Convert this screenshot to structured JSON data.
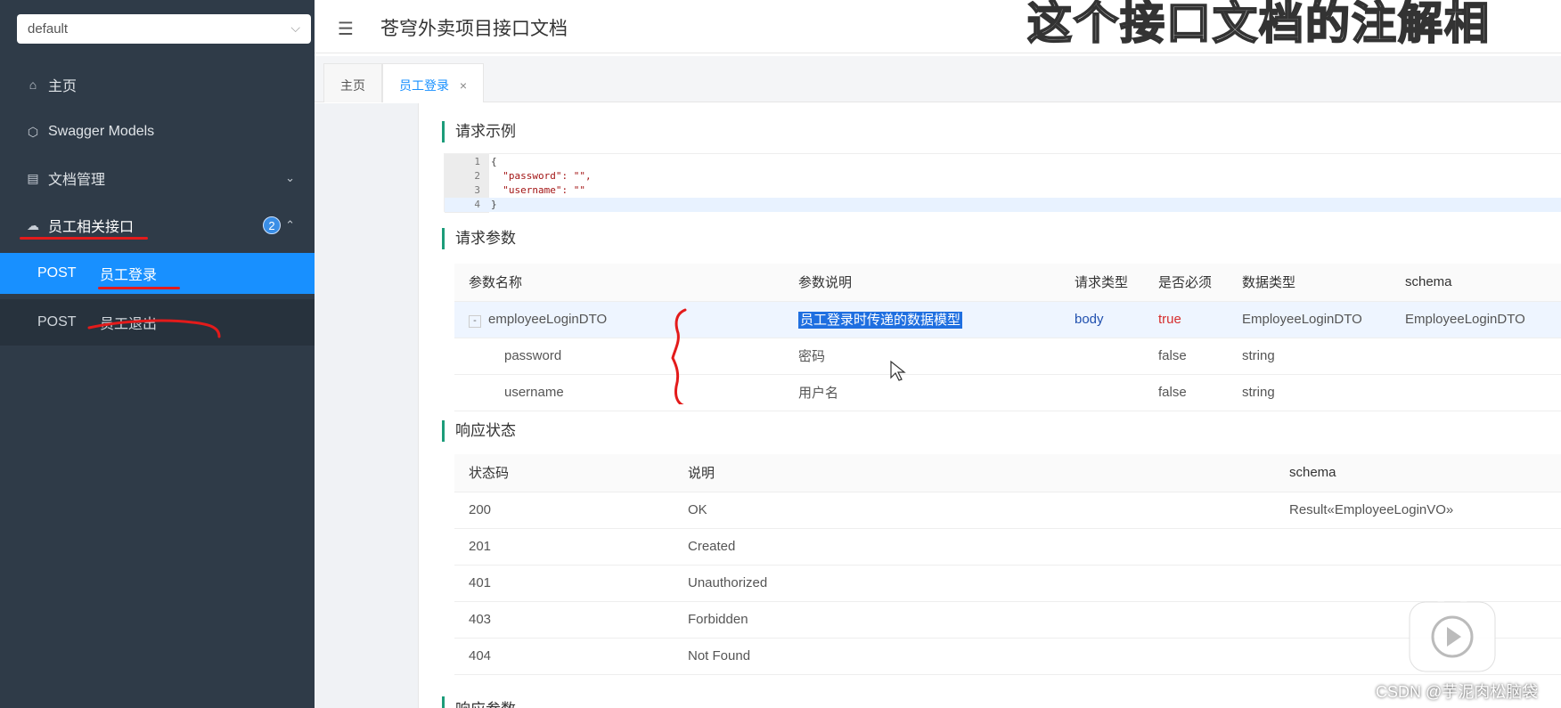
{
  "sidebar": {
    "group_select": {
      "value": "default"
    },
    "items": [
      {
        "label": "主页",
        "icon": "home-icon"
      },
      {
        "label": "Swagger Models",
        "icon": "cube-icon"
      },
      {
        "label": "文档管理",
        "icon": "document-icon"
      },
      {
        "label": "员工相关接口",
        "icon": "cloud-icon",
        "badge": "2"
      }
    ],
    "sub_items": [
      {
        "method": "POST",
        "label": "员工登录",
        "active": true
      },
      {
        "method": "POST",
        "label": "员工退出",
        "active": false
      }
    ]
  },
  "header": {
    "title": "苍穹外卖项目接口文档",
    "overlay_caption": "这个接口文档的注解相",
    "menu_icon": "menu-fold-icon"
  },
  "tabs": [
    {
      "label": "主页"
    },
    {
      "label": "员工登录",
      "close": "×"
    }
  ],
  "request_example": {
    "title": "请求示例",
    "lines": [
      {
        "n": "1",
        "text": "{"
      },
      {
        "n": "2",
        "text": "  \"password\": \"\","
      },
      {
        "n": "3",
        "text": "  \"username\": \"\""
      },
      {
        "n": "4",
        "text": "}"
      }
    ]
  },
  "request_params": {
    "title": "请求参数",
    "headers": [
      "参数名称",
      "参数说明",
      "请求类型",
      "是否必须",
      "数据类型",
      "schema"
    ],
    "rows": [
      {
        "name": "employeeLoginDTO",
        "desc": "员工登录时传递的数据模型",
        "in": "body",
        "required": "true",
        "type": "EmployeeLoginDTO",
        "schema": "EmployeeLoginDTO",
        "toggle": "-"
      },
      {
        "name": "password",
        "desc": "密码",
        "in": "",
        "required": "false",
        "type": "string",
        "schema": ""
      },
      {
        "name": "username",
        "desc": "用户名",
        "in": "",
        "required": "false",
        "type": "string",
        "schema": ""
      }
    ]
  },
  "response_status": {
    "title": "响应状态",
    "headers": [
      "状态码",
      "说明",
      "schema"
    ],
    "rows": [
      {
        "code": "200",
        "desc": "OK",
        "schema": "Result«EmployeeLoginVO»"
      },
      {
        "code": "201",
        "desc": "Created",
        "schema": ""
      },
      {
        "code": "401",
        "desc": "Unauthorized",
        "schema": ""
      },
      {
        "code": "403",
        "desc": "Forbidden",
        "schema": ""
      },
      {
        "code": "404",
        "desc": "Not Found",
        "schema": ""
      }
    ]
  },
  "response_params": {
    "title": "响应参数"
  },
  "watermark": "CSDN @芋泥肉松脑袋",
  "colors": {
    "sidebar_bg": "#2f3b48",
    "active_blue": "#1890ff",
    "section_accent": "#1c9c7a",
    "annotation_red": "#e31b1b"
  }
}
